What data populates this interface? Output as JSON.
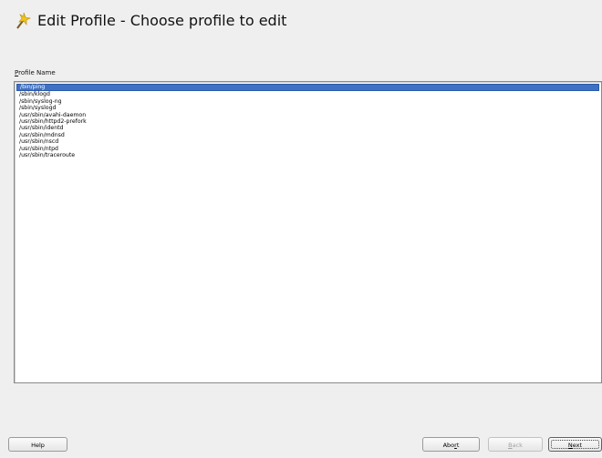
{
  "header": {
    "title": "Edit Profile - Choose profile to edit",
    "icon": "wand-icon"
  },
  "profiles": {
    "label": "Profile Name",
    "items": [
      "/bin/ping",
      "/sbin/klogd",
      "/sbin/syslog-ng",
      "/sbin/syslogd",
      "/usr/sbin/avahi-daemon",
      "/usr/sbin/httpd2-prefork",
      "/usr/sbin/identd",
      "/usr/sbin/mdnsd",
      "/usr/sbin/nscd",
      "/usr/sbin/ntpd",
      "/usr/sbin/traceroute"
    ],
    "selected_index": 0
  },
  "buttons": {
    "help": "Help",
    "abort": "Abort",
    "back": "Back",
    "next": "Next"
  },
  "colors": {
    "selection": "#3e71c4",
    "background": "#efefef"
  }
}
